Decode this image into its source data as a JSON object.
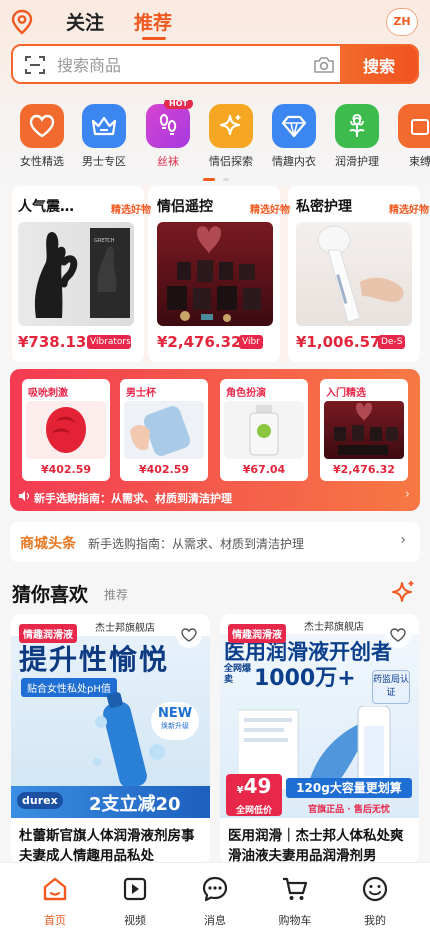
{
  "header": {
    "tabs": [
      {
        "label": "关注",
        "active": false
      },
      {
        "label": "推荐",
        "active": true
      }
    ],
    "lang_badge": "ZH"
  },
  "search": {
    "placeholder": "搜索商品",
    "button": "搜索"
  },
  "categories": [
    {
      "label": "女性精选",
      "icon": "heart-icon",
      "color": "#f26a2e"
    },
    {
      "label": "男士专区",
      "icon": "crown-icon",
      "color": "#3b86f0"
    },
    {
      "label": "丝袜",
      "icon": "footprint-icon",
      "color": "#c23fd8",
      "badge": "HOT"
    },
    {
      "label": "情侣探索",
      "icon": "sparkle-icon",
      "color": "#f5a623"
    },
    {
      "label": "情趣内衣",
      "icon": "diamond-icon",
      "color": "#3b86f0"
    },
    {
      "label": "润滑护理",
      "icon": "flower-icon",
      "color": "#3dbb4c"
    },
    {
      "label": "束缚",
      "icon": "box-icon",
      "color": "#f26a2e"
    }
  ],
  "features": [
    {
      "title": "人气震…",
      "badge": "精选好物",
      "price": "¥738.13",
      "tag": "Vibrators"
    },
    {
      "title": "情侣遥控",
      "badge": "精选好物",
      "price": "¥2,476.32",
      "tag": "Vibr"
    },
    {
      "title": "私密护理",
      "badge": "精选好物",
      "price": "¥1,006.57",
      "tag": "De-S"
    }
  ],
  "promo": {
    "items": [
      {
        "title": "吸吮刺激",
        "price": "¥402.59"
      },
      {
        "title": "男士杯",
        "price": "¥402.59"
      },
      {
        "title": "角色扮演",
        "price": "¥67.04"
      },
      {
        "title": "入门精选",
        "price": "¥2,476.32"
      }
    ],
    "text": "新手选购指南：从需求、材质到清洁护理"
  },
  "headline": {
    "label": "商城头条",
    "text": "新手选购指南：从需求、材质到清洁护理"
  },
  "guess": {
    "title": "猜你喜欢",
    "subtitle": "推荐"
  },
  "products": [
    {
      "tag": "情趣润滑液",
      "store": "杰士邦旗舰店",
      "img_headline": "提升性愉悦",
      "img_sub": "贴合女性私处pH值",
      "img_new": "NEW",
      "img_new_sub": "焕新升级",
      "img_brand": "durex",
      "img_offer": "2支立减20",
      "name": "杜蕾斯官旗人体润滑液剂房事夫妻成人情趣用品私处"
    },
    {
      "tag": "情趣润滑液",
      "store": "杰士邦旗舰店",
      "img_headline": "医用润滑液开创者",
      "img_sub": "全网爆卖",
      "img_big": "1000万+",
      "img_seal": "药监局认证",
      "img_price": "49",
      "img_price_prefix": "¥",
      "img_price_label": "全网低价",
      "img_cap": "120g大容量更划算",
      "img_guarantee": "官旗正品 · 售后无忧",
      "name": "医用润滑｜杰士邦人体私处爽滑油液夫妻用品润滑剂男"
    }
  ],
  "nav": [
    {
      "label": "首页",
      "icon": "home-icon",
      "active": true
    },
    {
      "label": "视频",
      "icon": "video-icon",
      "active": false
    },
    {
      "label": "消息",
      "icon": "message-icon",
      "active": false
    },
    {
      "label": "购物车",
      "icon": "cart-icon",
      "active": false
    },
    {
      "label": "我的",
      "icon": "profile-icon",
      "active": false
    }
  ],
  "colors": {
    "accent": "#f05a22",
    "price": "#e3263c",
    "tag": "#e8284a"
  }
}
